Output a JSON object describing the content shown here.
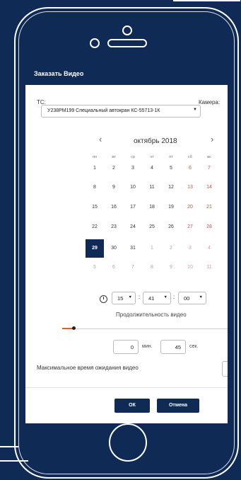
{
  "modal": {
    "title": "Заказать Видео"
  },
  "form": {
    "vehicle_label": "ТС:",
    "vehicle_value": "У238РМ199 Специальный автокран КС-55713-1К",
    "camera_label": "Камера:"
  },
  "calendar": {
    "month_title": "октябрь 2018",
    "prev": "‹",
    "next": "›",
    "weekdays": [
      "пн",
      "вт",
      "ср",
      "чт",
      "пт",
      "сб",
      "вс"
    ],
    "weeks": [
      [
        "1",
        "2",
        "3",
        "4",
        "5",
        "6",
        "7"
      ],
      [
        "8",
        "9",
        "10",
        "11",
        "12",
        "13",
        "14"
      ],
      [
        "15",
        "16",
        "17",
        "18",
        "19",
        "20",
        "21"
      ],
      [
        "22",
        "23",
        "24",
        "25",
        "26",
        "27",
        "28"
      ],
      [
        "29",
        "30",
        "31",
        "1",
        "2",
        "3",
        "4"
      ],
      [
        "5",
        "6",
        "7",
        "8",
        "9",
        "10",
        "11"
      ]
    ],
    "selected_day": "29"
  },
  "time": {
    "hour": "15",
    "minute": "41",
    "second": "00",
    "separator": ":"
  },
  "duration": {
    "label": "Продолжительность видео",
    "slider_fraction": 0.07,
    "minutes_value": "0",
    "minutes_unit": "мин.",
    "seconds_value": "45",
    "seconds_unit": "сек."
  },
  "wait": {
    "label": "Максимальное время ожидания видео"
  },
  "buttons": {
    "ok": "ОК",
    "cancel": "Отмена"
  },
  "colors": {
    "primary": "#0f2a55",
    "weekend": "#d34a4a",
    "slider": "#e06020"
  }
}
